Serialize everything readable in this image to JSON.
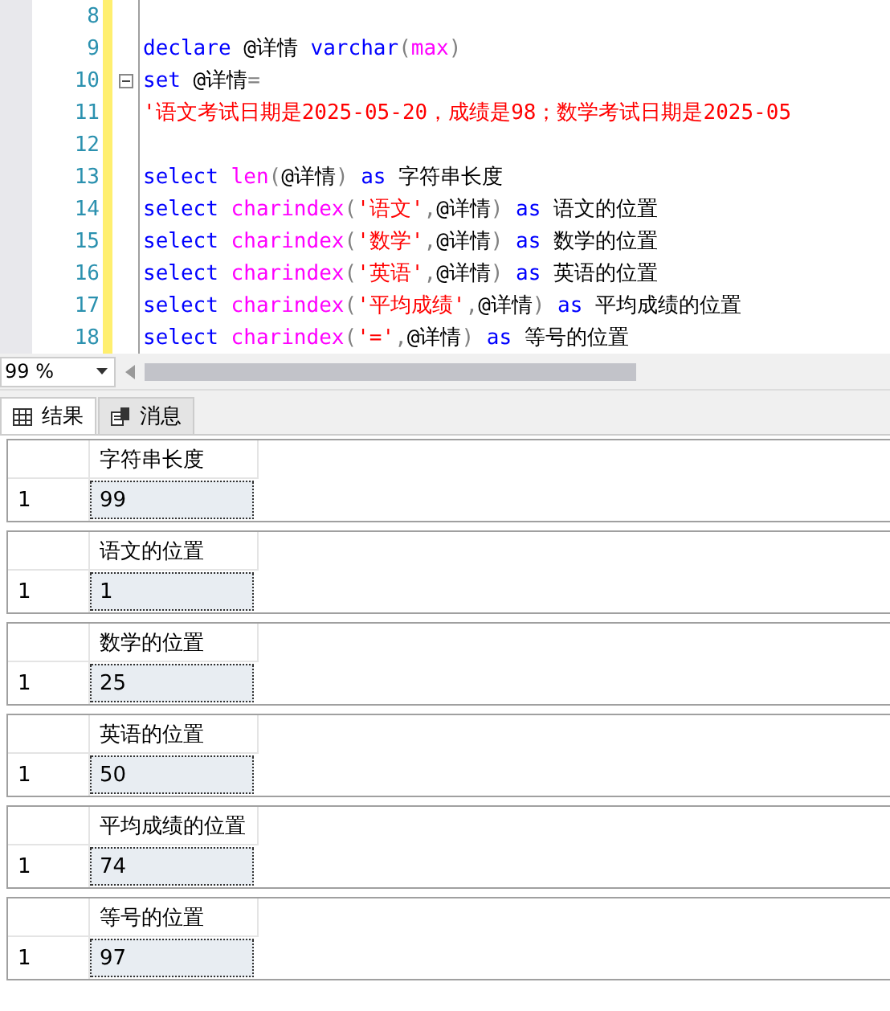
{
  "editor": {
    "lines": [
      {
        "number": "8"
      },
      {
        "number": "9",
        "tokens": [
          {
            "kind": "kw",
            "text": "declare"
          },
          {
            "kind": "plain",
            "text": " @详情"
          },
          {
            "kind": "kw",
            "text": " varchar"
          },
          {
            "kind": "op",
            "text": "("
          },
          {
            "kind": "fn",
            "text": "max"
          },
          {
            "kind": "op",
            "text": ")"
          }
        ]
      },
      {
        "number": "10",
        "collapse": true,
        "tokens": [
          {
            "kind": "kw",
            "text": "set"
          },
          {
            "kind": "plain",
            "text": " @详情"
          },
          {
            "kind": "op",
            "text": "="
          }
        ]
      },
      {
        "number": "11",
        "tokens": [
          {
            "kind": "str",
            "text": "'语文考试日期是2025-05-20，成绩是98；数学考试日期是2025-05"
          }
        ]
      },
      {
        "number": "12"
      },
      {
        "number": "13",
        "tokens": [
          {
            "kind": "kw",
            "text": "select"
          },
          {
            "kind": "fn",
            "text": " len"
          },
          {
            "kind": "op",
            "text": "("
          },
          {
            "kind": "plain",
            "text": "@详情"
          },
          {
            "kind": "op",
            "text": ")"
          },
          {
            "kind": "kw",
            "text": " as"
          },
          {
            "kind": "plain",
            "text": " 字符串长度"
          }
        ]
      },
      {
        "number": "14",
        "tokens": [
          {
            "kind": "kw",
            "text": "select"
          },
          {
            "kind": "fn",
            "text": " charindex"
          },
          {
            "kind": "op",
            "text": "("
          },
          {
            "kind": "str",
            "text": "'语文'"
          },
          {
            "kind": "op",
            "text": ","
          },
          {
            "kind": "plain",
            "text": "@详情"
          },
          {
            "kind": "op",
            "text": ")"
          },
          {
            "kind": "kw",
            "text": " as"
          },
          {
            "kind": "plain",
            "text": " 语文的位置"
          }
        ]
      },
      {
        "number": "15",
        "tokens": [
          {
            "kind": "kw",
            "text": "select"
          },
          {
            "kind": "fn",
            "text": " charindex"
          },
          {
            "kind": "op",
            "text": "("
          },
          {
            "kind": "str",
            "text": "'数学'"
          },
          {
            "kind": "op",
            "text": ","
          },
          {
            "kind": "plain",
            "text": "@详情"
          },
          {
            "kind": "op",
            "text": ")"
          },
          {
            "kind": "kw",
            "text": " as"
          },
          {
            "kind": "plain",
            "text": " 数学的位置"
          }
        ]
      },
      {
        "number": "16",
        "tokens": [
          {
            "kind": "kw",
            "text": "select"
          },
          {
            "kind": "fn",
            "text": " charindex"
          },
          {
            "kind": "op",
            "text": "("
          },
          {
            "kind": "str",
            "text": "'英语'"
          },
          {
            "kind": "op",
            "text": ","
          },
          {
            "kind": "plain",
            "text": "@详情"
          },
          {
            "kind": "op",
            "text": ")"
          },
          {
            "kind": "kw",
            "text": " as"
          },
          {
            "kind": "plain",
            "text": " 英语的位置"
          }
        ]
      },
      {
        "number": "17",
        "tokens": [
          {
            "kind": "kw",
            "text": "select"
          },
          {
            "kind": "fn",
            "text": " charindex"
          },
          {
            "kind": "op",
            "text": "("
          },
          {
            "kind": "str",
            "text": "'平均成绩'"
          },
          {
            "kind": "op",
            "text": ","
          },
          {
            "kind": "plain",
            "text": "@详情"
          },
          {
            "kind": "op",
            "text": ")"
          },
          {
            "kind": "kw",
            "text": " as"
          },
          {
            "kind": "plain",
            "text": " 平均成绩的位置"
          }
        ]
      },
      {
        "number": "18",
        "tokens": [
          {
            "kind": "kw",
            "text": "select"
          },
          {
            "kind": "fn",
            "text": " charindex"
          },
          {
            "kind": "op",
            "text": "("
          },
          {
            "kind": "str",
            "text": "'='"
          },
          {
            "kind": "op",
            "text": ","
          },
          {
            "kind": "plain",
            "text": "@详情"
          },
          {
            "kind": "op",
            "text": ")"
          },
          {
            "kind": "kw",
            "text": " as"
          },
          {
            "kind": "plain",
            "text": " 等号的位置"
          }
        ]
      }
    ]
  },
  "zoom": {
    "value": "99 %"
  },
  "tabs": [
    {
      "label": "结果",
      "selected": true
    },
    {
      "label": "消息",
      "selected": false
    }
  ],
  "results": [
    {
      "column": "字符串长度",
      "row_number": "1",
      "value": "99"
    },
    {
      "column": "语文的位置",
      "row_number": "1",
      "value": "1"
    },
    {
      "column": "数学的位置",
      "row_number": "1",
      "value": "25"
    },
    {
      "column": "英语的位置",
      "row_number": "1",
      "value": "50"
    },
    {
      "column": "平均成绩的位置",
      "row_number": "1",
      "value": "74"
    },
    {
      "column": "等号的位置",
      "row_number": "1",
      "value": "97"
    }
  ]
}
